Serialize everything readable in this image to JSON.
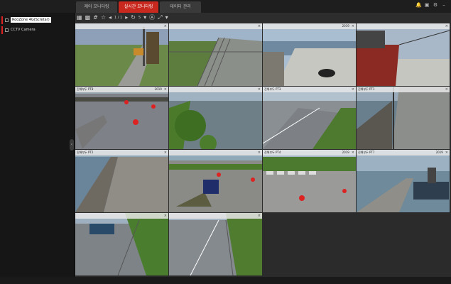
{
  "tabs": [
    {
      "label": "제어 모니터링",
      "active": false
    },
    {
      "label": "실시간 모니터링",
      "active": true
    },
    {
      "label": "데이터 관리",
      "active": false
    }
  ],
  "top_icons": [
    "bell-icon",
    "monitor-icon",
    "gear-icon",
    "minimize-icon"
  ],
  "sidebar": {
    "items": [
      {
        "label": "RooZone 4G(Scretar)",
        "selected": true
      },
      {
        "label": "CCTV Camera",
        "selected": false
      }
    ]
  },
  "toolbar": {
    "page_indicator": "1 / 1",
    "counter": "5"
  },
  "cameras": [
    {
      "name": "",
      "ts": "",
      "scene": "crane"
    },
    {
      "name": "",
      "ts": "",
      "scene": "fence"
    },
    {
      "name": "",
      "ts": "2019",
      "scene": "pier-car"
    },
    {
      "name": "",
      "ts": "",
      "scene": "ship"
    },
    {
      "name": "진해부두 PT8",
      "ts": "2019",
      "scene": "road-cones"
    },
    {
      "name": "",
      "ts": "",
      "scene": "tree-sea"
    },
    {
      "name": "진해부두 PT3",
      "ts": "",
      "scene": "road-coast"
    },
    {
      "name": "진해부두 PT1",
      "ts": "",
      "scene": "pier-fence"
    },
    {
      "name": "진해부두 PT2",
      "ts": "",
      "scene": "breakwater"
    },
    {
      "name": "",
      "ts": "",
      "scene": "pier-red"
    },
    {
      "name": "진해부두 PT4",
      "ts": "2019",
      "scene": "parking"
    },
    {
      "name": "진해부두 PT7",
      "ts": "2019",
      "scene": "boats"
    },
    {
      "name": "",
      "ts": "",
      "scene": "truck"
    },
    {
      "name": "",
      "ts": "",
      "scene": "road-trees"
    }
  ]
}
